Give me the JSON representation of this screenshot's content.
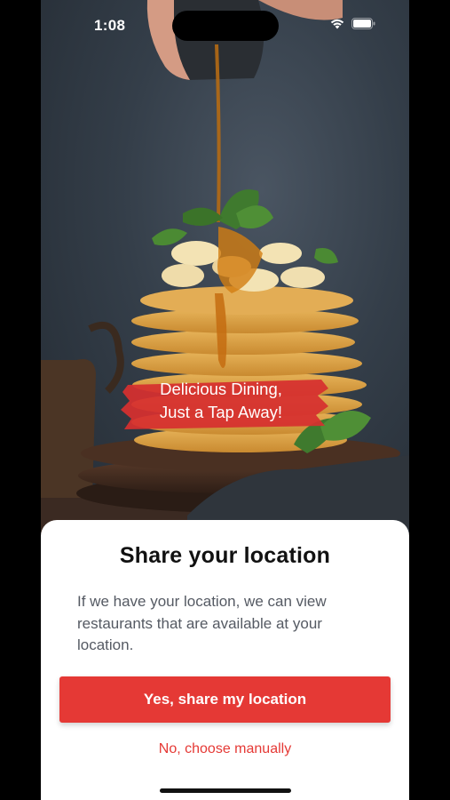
{
  "status_bar": {
    "time": "1:08",
    "icons": [
      "wifi-icon",
      "battery-icon"
    ]
  },
  "hero": {
    "image": "pancake-stack-with-syrup-photo",
    "tagline_line1": "Delicious Dining,",
    "tagline_line2": "Just a Tap Away!"
  },
  "sheet": {
    "title": "Share your location",
    "body": "If we have your location, we can view restaurants that are available at your location.",
    "primary_button": "Yes, share my location",
    "secondary_link": "No, choose manually"
  },
  "colors": {
    "accent": "#e53935",
    "title_text": "#111111",
    "body_text": "#555a63",
    "sheet_background": "#ffffff"
  }
}
